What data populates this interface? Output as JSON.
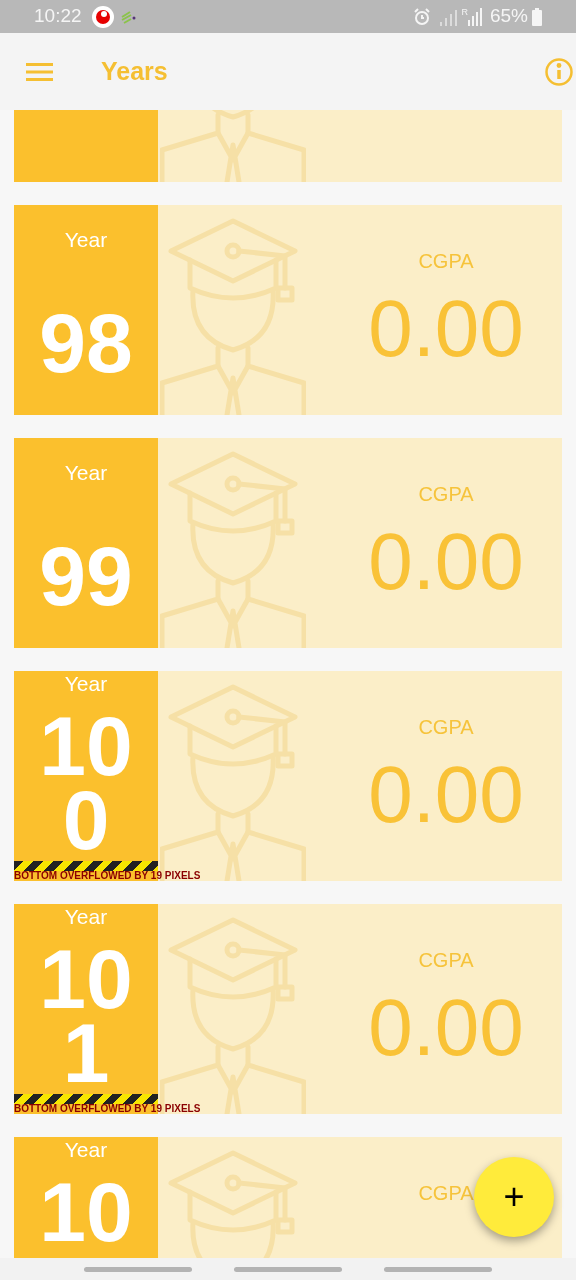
{
  "status_bar": {
    "time": "10:22",
    "roaming": "R",
    "battery": "65%"
  },
  "app_bar": {
    "title": "Years"
  },
  "years": [
    {
      "kind": "normal"
    },
    {
      "kind": "normal",
      "year_label": "Year",
      "number": "98",
      "cgpa_label": "CGPA",
      "cgpa": "0.00"
    },
    {
      "kind": "normal",
      "year_label": "Year",
      "number": "99",
      "cgpa_label": "CGPA",
      "cgpa": "0.00"
    },
    {
      "kind": "overflow",
      "year_label": "Year",
      "number": "100",
      "cgpa_label": "CGPA",
      "cgpa": "0.00",
      "overflow_warning": "BOTTOM OVERFLOWED BY 19 PIXELS"
    },
    {
      "kind": "overflow",
      "year_label": "Year",
      "number": "101",
      "cgpa_label": "CGPA",
      "cgpa": "0.00",
      "overflow_warning": "BOTTOM OVERFLOWED BY 19 PIXELS"
    },
    {
      "kind": "overflow",
      "year_label": "Year",
      "number": "10",
      "cgpa_label": "CGPA"
    }
  ],
  "fab": {
    "label": "+"
  }
}
